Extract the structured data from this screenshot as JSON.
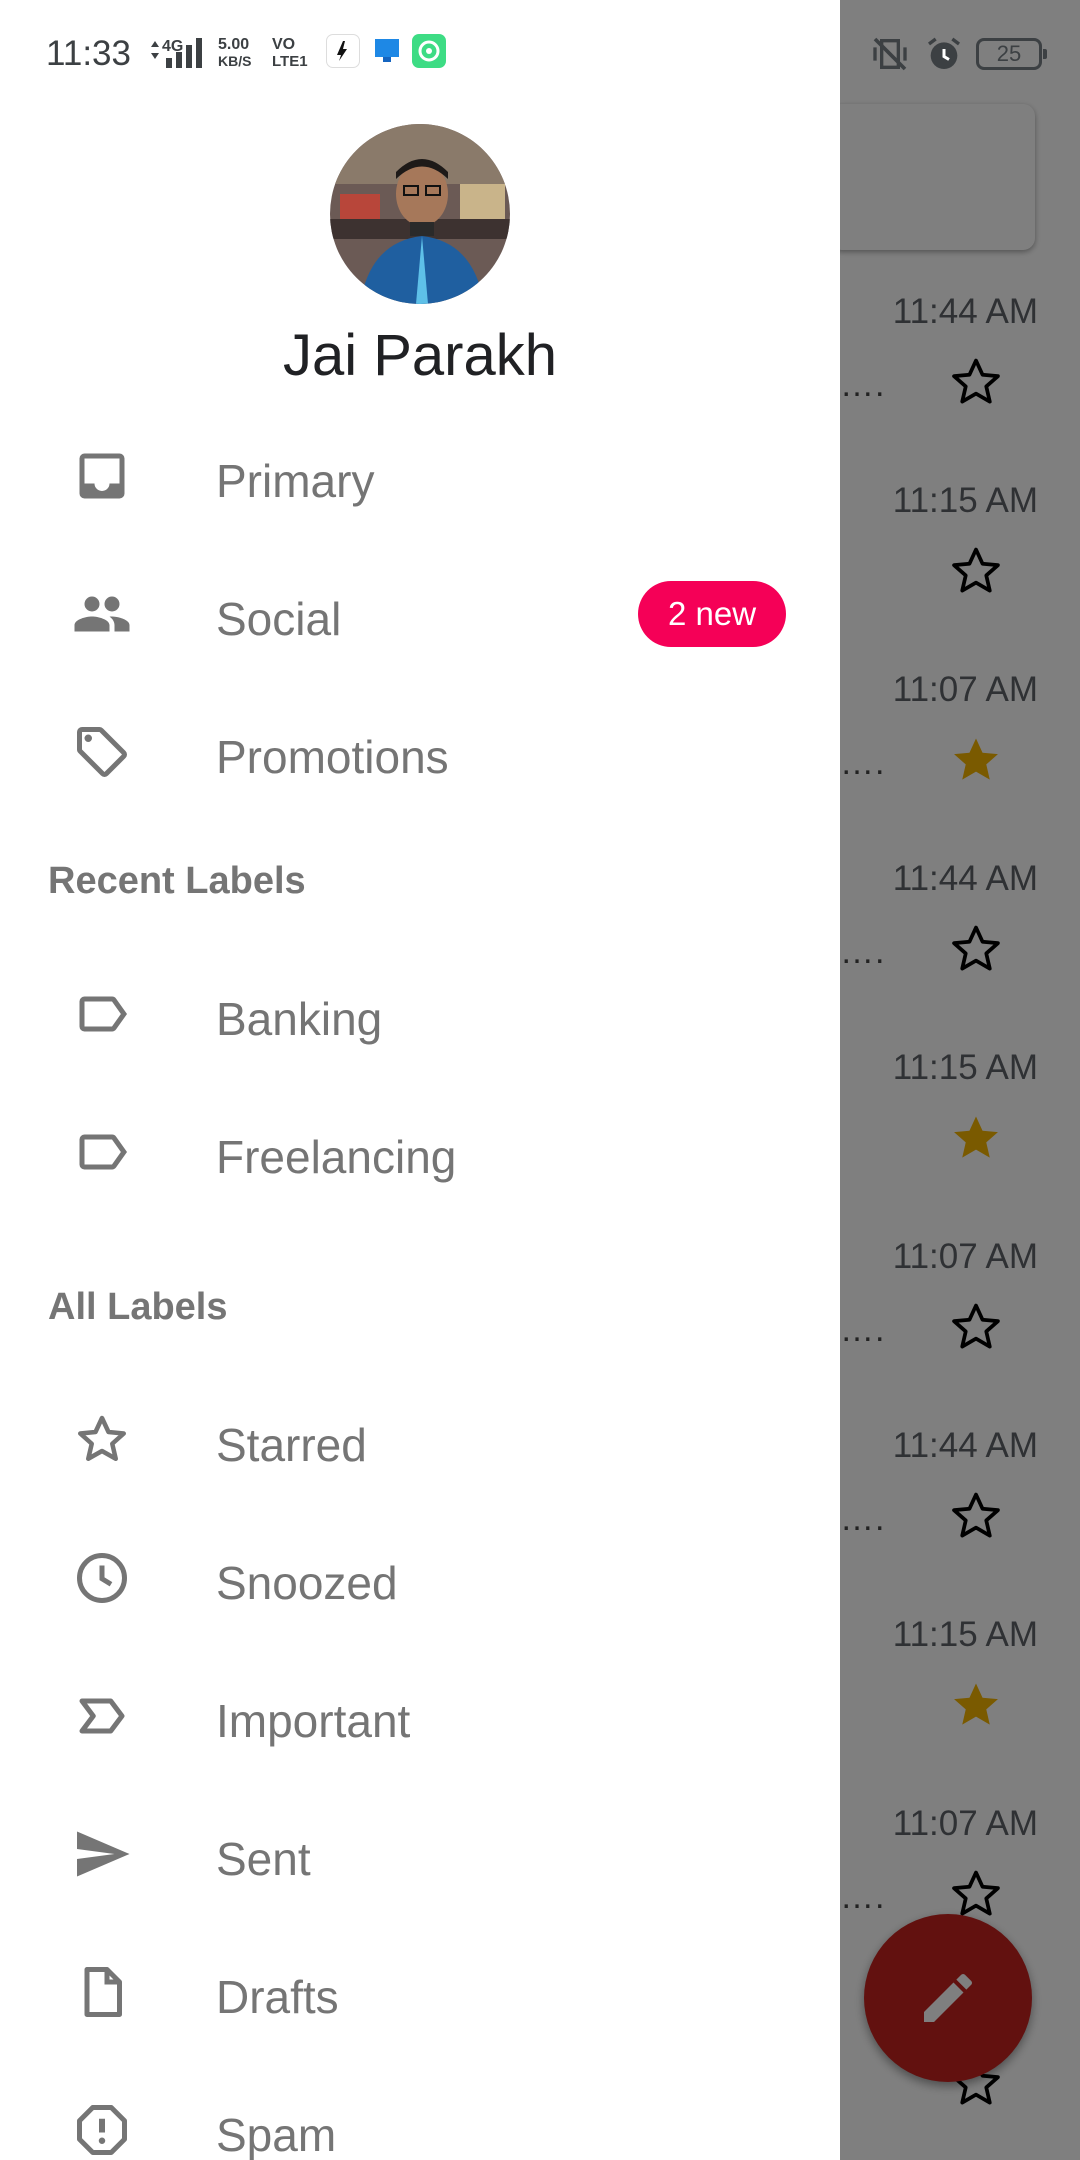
{
  "status_bar": {
    "time": "11:33",
    "network_type": "4G",
    "speed_value": "5.00",
    "speed_unit": "KB/S",
    "volte_top": "VO",
    "volte_bottom": "LTE1",
    "battery_level": "25"
  },
  "account": {
    "name": "Jai Parakh"
  },
  "categories": [
    {
      "label": "Primary",
      "icon": "inbox-icon"
    },
    {
      "label": "Social",
      "icon": "people-icon",
      "badge": "2 new"
    },
    {
      "label": "Promotions",
      "icon": "tag-icon"
    }
  ],
  "recent_labels": {
    "heading": "Recent Labels",
    "items": [
      {
        "label": "Banking",
        "icon": "label-icon"
      },
      {
        "label": "Freelancing",
        "icon": "label-icon"
      }
    ]
  },
  "all_labels": {
    "heading": "All Labels",
    "items": [
      {
        "label": "Starred",
        "icon": "star-icon"
      },
      {
        "label": "Snoozed",
        "icon": "clock-icon"
      },
      {
        "label": "Important",
        "icon": "important-icon"
      },
      {
        "label": "Sent",
        "icon": "send-icon"
      },
      {
        "label": "Drafts",
        "icon": "draft-icon"
      },
      {
        "label": "Spam",
        "icon": "spam-icon"
      }
    ]
  },
  "inbox_background": {
    "rows": [
      {
        "time": "11:44 AM",
        "starred": false
      },
      {
        "time": "11:15 AM",
        "starred": false
      },
      {
        "time": "11:07 AM",
        "starred": true
      },
      {
        "time": "11:44 AM",
        "starred": false
      },
      {
        "time": "11:15 AM",
        "starred": true
      },
      {
        "time": "11:07 AM",
        "starred": false
      },
      {
        "time": "11:44 AM",
        "starred": false
      },
      {
        "time": "11:15 AM",
        "starred": true
      },
      {
        "time": "11:07 AM",
        "starred": false
      },
      {
        "time": "",
        "starred": false
      }
    ],
    "ellipsis": "…."
  },
  "colors": {
    "badge": "#f50057",
    "star_filled": "#f4b400",
    "compose": "#c5221f",
    "icon": "#757575"
  }
}
